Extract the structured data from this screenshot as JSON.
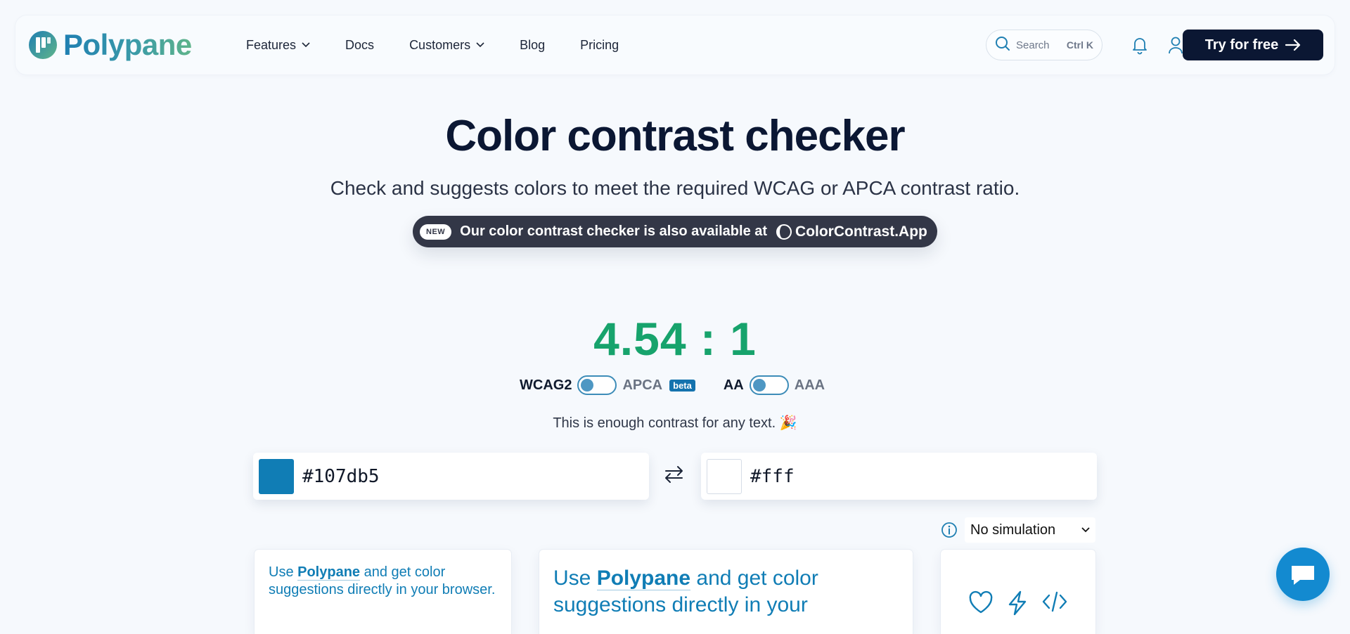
{
  "brand": {
    "name": "Polypane"
  },
  "nav": {
    "items": [
      {
        "label": "Features",
        "has_dropdown": true
      },
      {
        "label": "Docs",
        "has_dropdown": false
      },
      {
        "label": "Customers",
        "has_dropdown": true
      },
      {
        "label": "Blog",
        "has_dropdown": false
      },
      {
        "label": "Pricing",
        "has_dropdown": false
      }
    ]
  },
  "search": {
    "placeholder": "Search",
    "shortcut": "Ctrl K"
  },
  "header_icons": [
    "bell-icon",
    "user-icon"
  ],
  "cta": {
    "label": "Try for free"
  },
  "hero": {
    "title": "Color contrast checker",
    "subtitle": "Check and suggests colors to meet the required WCAG or APCA contrast ratio.",
    "announcement": {
      "badge": "NEW",
      "text": "Our color contrast checker is also available at",
      "link": "ColorContrast.App"
    }
  },
  "result": {
    "ratio": "4.54 : 1",
    "algorithm_toggle": {
      "left": "WCAG2",
      "right": "APCA",
      "tag": "beta",
      "selected": "WCAG2"
    },
    "level_toggle": {
      "left": "AA",
      "right": "AAA",
      "selected": "AA"
    },
    "message": "This is enough contrast for any text. 🎉"
  },
  "colors": {
    "foreground": {
      "value": "#107db5",
      "swatch": "#107db5"
    },
    "background": {
      "value": "#fff",
      "swatch": "#ffffff"
    }
  },
  "simulation": {
    "selected": "No simulation"
  },
  "preview": {
    "prefix": "Use ",
    "brand": "Polypane",
    "suffix_small": " and get color suggestions directly in your browser.",
    "suffix_large": " and get color suggestions directly in your"
  },
  "theme": {
    "accent": "#107db5",
    "ratio_pass": "#17a36c",
    "cta_bg": "#0b1733",
    "chat": "#138ad0"
  }
}
